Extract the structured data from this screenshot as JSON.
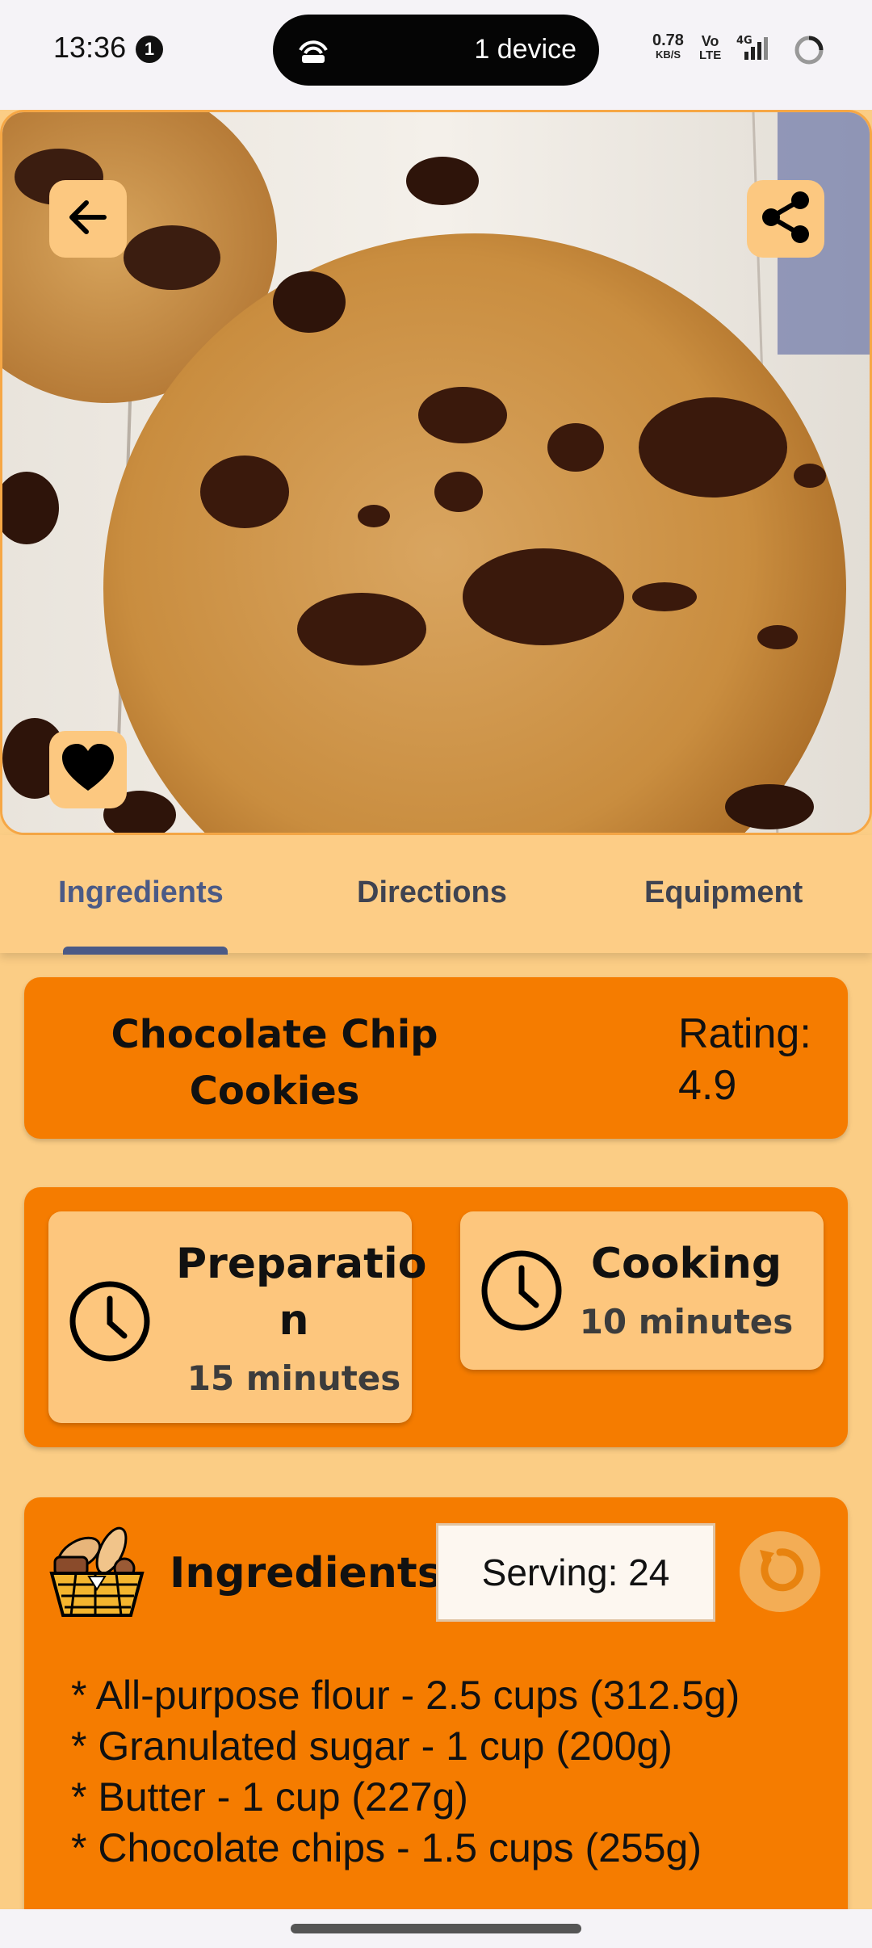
{
  "status_bar": {
    "time": "13:36",
    "notification_count": "1",
    "device_pill_text": "1 device",
    "net_speed_value": "0.78",
    "net_speed_unit": "KB/S",
    "volte_top": "Vo",
    "volte_bottom": "LTE",
    "network": "4G",
    "icons": [
      "hotspot-icon",
      "signal-icon",
      "battery-icon"
    ]
  },
  "hero": {
    "back_icon": "arrow-left-icon",
    "share_icon": "share-icon",
    "favorite_icon": "heart-icon",
    "image_subject": "cookie-photo"
  },
  "tabs": {
    "items": [
      {
        "label": "Ingredients",
        "active": true
      },
      {
        "label": "Directions",
        "active": false
      },
      {
        "label": "Equipment",
        "active": false
      }
    ]
  },
  "recipe": {
    "title_line1": "Chocolate Chip",
    "title_line2": "Cookies",
    "rating_label": "Rating:",
    "rating_value": "4.9"
  },
  "times": {
    "prep_label_line1": "Preparatio",
    "prep_label_line2": "n",
    "prep_value": "15 minutes",
    "cook_label": "Cooking",
    "cook_value": "10 minutes"
  },
  "ingredients": {
    "heading": "Ingredients",
    "serving_label": "Serving: 24",
    "items": [
      "* All-purpose flour - 2.5 cups (312.5g)",
      "* Granulated sugar - 1 cup (200g)",
      "* Butter - 1 cup (227g)",
      "* Chocolate chips - 1.5 cups (255g)"
    ]
  },
  "colors": {
    "accent_orange": "#f57c00",
    "panel_peach": "#fdc67d",
    "background": "#fbcd85",
    "tab_active": "#4b5a86"
  }
}
